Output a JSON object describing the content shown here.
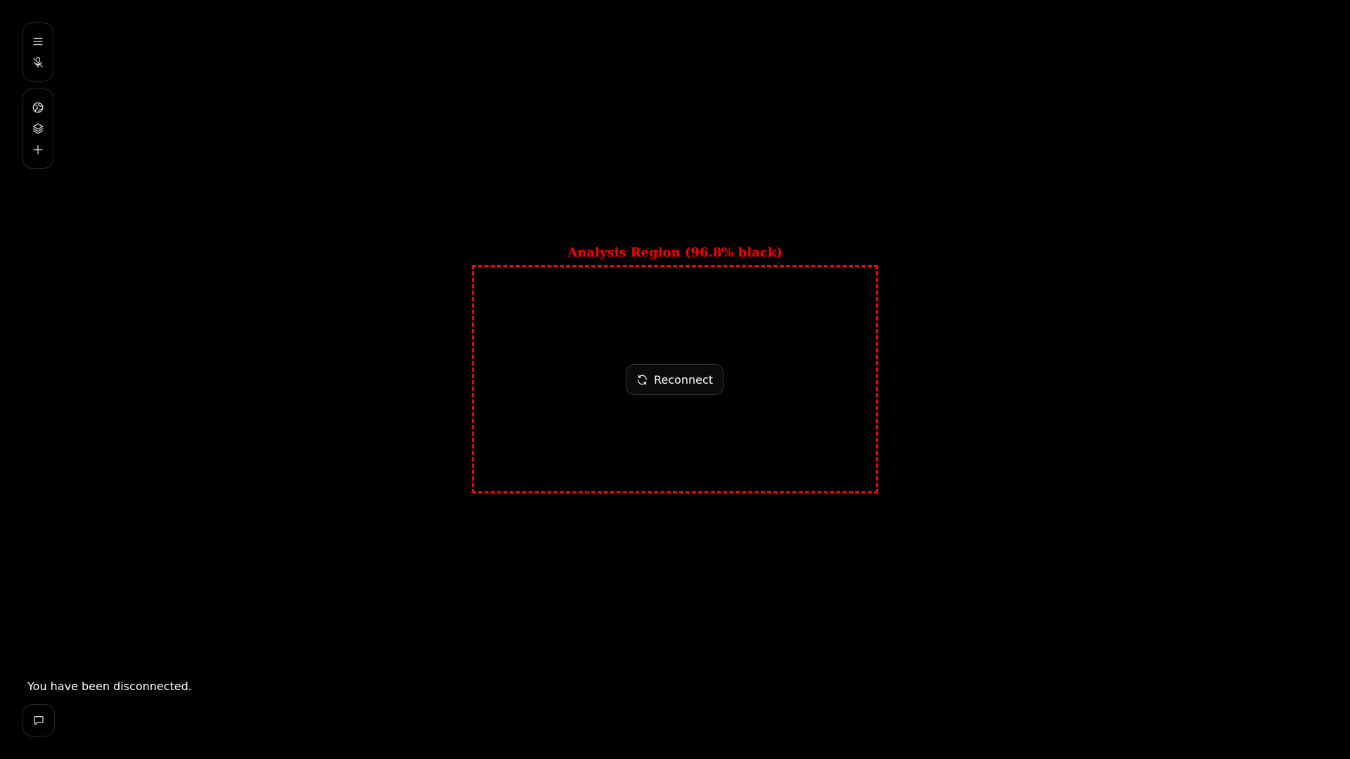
{
  "toolbar": {
    "top_group": [
      {
        "icon": "menu-icon"
      },
      {
        "icon": "mic-off-icon"
      }
    ],
    "middle_group": [
      {
        "icon": "globe-icon"
      },
      {
        "icon": "layers-icon"
      },
      {
        "icon": "plus-icon"
      }
    ]
  },
  "overlay": {
    "label": "Analysis Region (96.8% black)",
    "color": "#ff0000"
  },
  "main": {
    "reconnect_label": "Reconnect",
    "reconnect_icon": "refresh-icon"
  },
  "status": {
    "message": "You have been disconnected.",
    "chat_icon": "chat-icon"
  },
  "colors": {
    "background": "#000000",
    "foreground": "#ffffff",
    "border": "#2a2a2a"
  }
}
